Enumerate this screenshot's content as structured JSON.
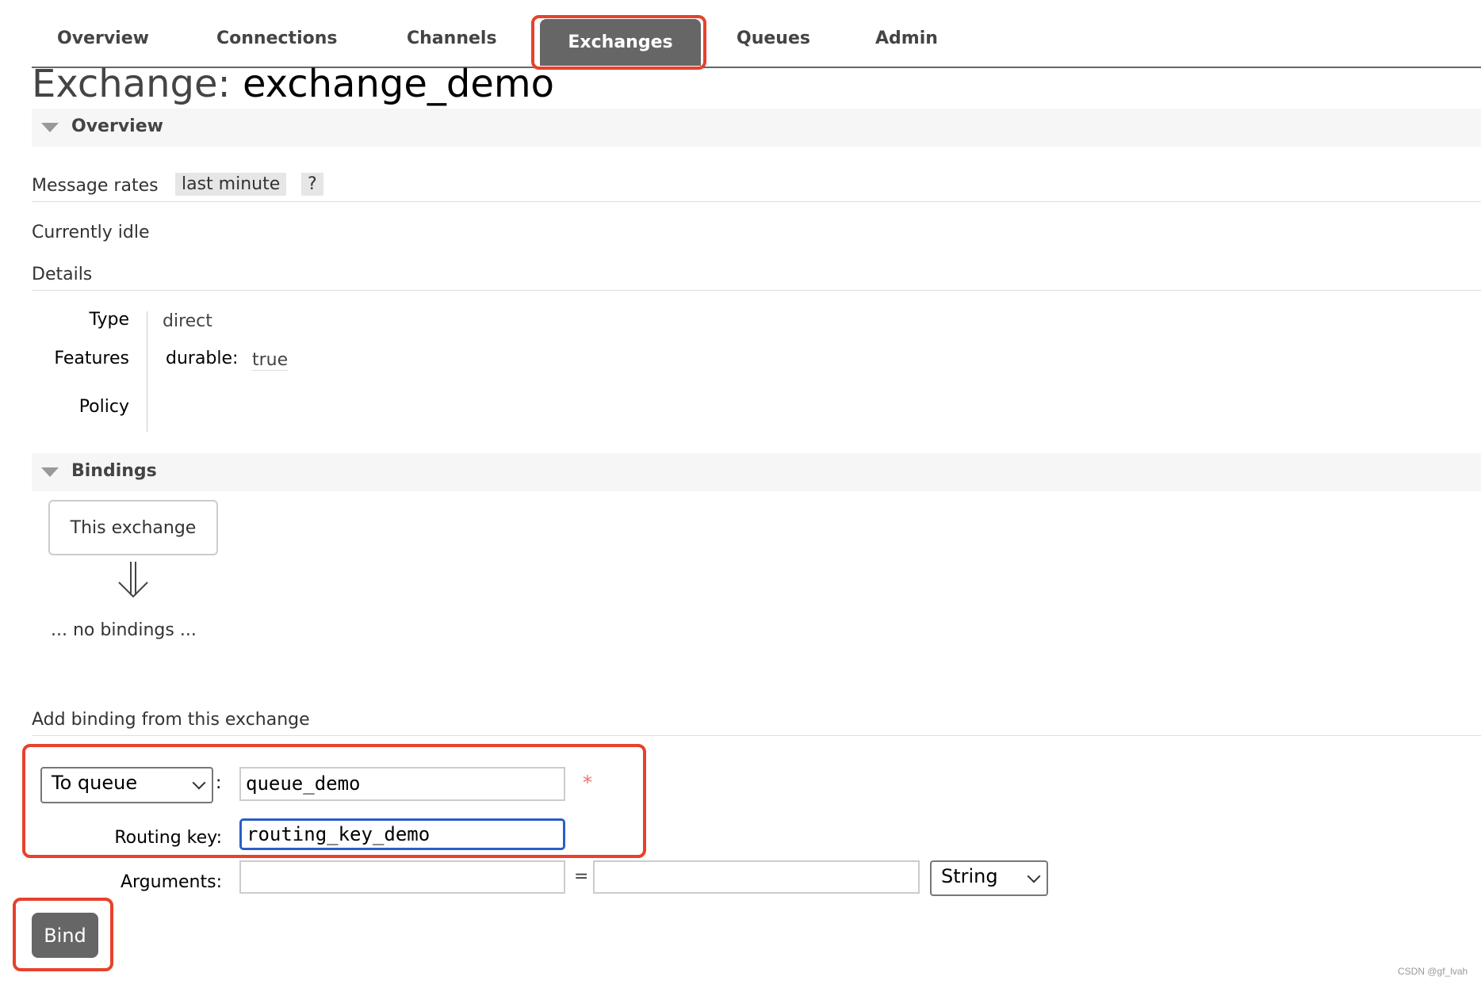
{
  "nav": {
    "tabs": [
      {
        "label": "Overview"
      },
      {
        "label": "Connections"
      },
      {
        "label": "Channels"
      },
      {
        "label": "Exchanges",
        "active": true
      },
      {
        "label": "Queues"
      },
      {
        "label": "Admin"
      }
    ]
  },
  "page": {
    "title_prefix": "Exchange:",
    "title_name": "exchange_demo"
  },
  "overview": {
    "section_label": "Overview",
    "message_rates_label": "Message rates",
    "rate_period": "last minute",
    "help": "?",
    "status": "Currently idle",
    "details_label": "Details",
    "details": {
      "type_label": "Type",
      "type_value": "direct",
      "features_label": "Features",
      "durable_label": "durable:",
      "durable_value": "true",
      "policy_label": "Policy"
    }
  },
  "bindings": {
    "section_label": "Bindings",
    "source_box": "This exchange",
    "empty_text": "... no bindings ..."
  },
  "add_binding": {
    "heading": "Add binding from this exchange",
    "destination_type": "To queue",
    "colon": ":",
    "destination_value": "queue_demo",
    "required_mark": "*",
    "routing_key_label": "Routing key:",
    "routing_key_value": "routing_key_demo",
    "arguments_label": "Arguments:",
    "argument_key": "",
    "equals": "=",
    "argument_value": "",
    "argument_type": "String",
    "bind_button": "Bind"
  },
  "watermark": "CSDN @gf_lvah",
  "colors": {
    "highlight": "#e8412c",
    "focus": "#2a5dc8",
    "button": "#666666",
    "required": "#f07070"
  }
}
